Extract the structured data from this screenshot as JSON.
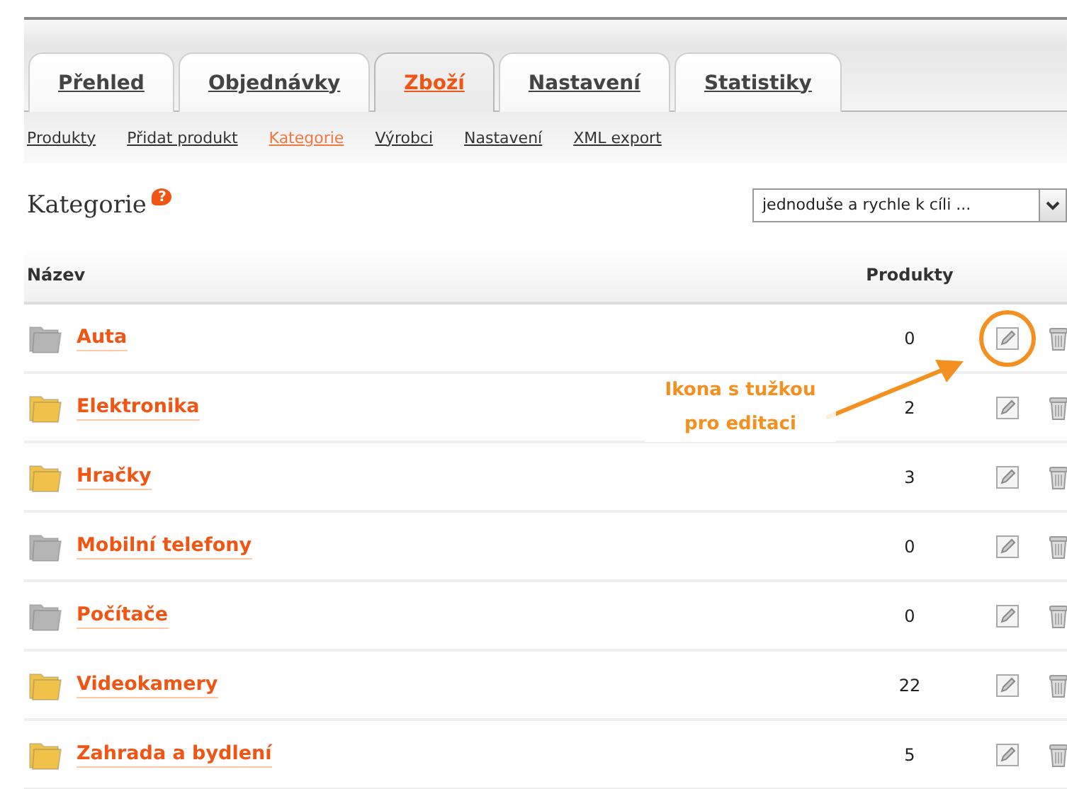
{
  "tabs": [
    {
      "label": "Přehled",
      "selected": false
    },
    {
      "label": "Objednávky",
      "selected": false
    },
    {
      "label": "Zboží",
      "selected": true
    },
    {
      "label": "Nastavení",
      "selected": false
    },
    {
      "label": "Statistiky",
      "selected": false
    }
  ],
  "subnav": [
    {
      "label": "Produkty",
      "selected": false
    },
    {
      "label": "Přidat produkt",
      "selected": false
    },
    {
      "label": "Kategorie",
      "selected": true
    },
    {
      "label": "Výrobci",
      "selected": false
    },
    {
      "label": "Nastavení",
      "selected": false
    },
    {
      "label": "XML export",
      "selected": false
    }
  ],
  "heading": {
    "title": "Kategorie",
    "help": "?"
  },
  "filter": {
    "value": "jednoduše a rychle k cíli ..."
  },
  "table": {
    "columns": [
      "Název",
      "Produkty"
    ],
    "rows": [
      {
        "name": "Auta",
        "products": "0",
        "color": "#b4b4b4",
        "highlighted": true
      },
      {
        "name": "Elektronika",
        "products": "2",
        "color": "#f0c24a",
        "highlighted": false
      },
      {
        "name": "Hračky",
        "products": "3",
        "color": "#f0c24a",
        "highlighted": false
      },
      {
        "name": "Mobilní telefony",
        "products": "0",
        "color": "#b4b4b4",
        "highlighted": false
      },
      {
        "name": "Počítače",
        "products": "0",
        "color": "#b4b4b4",
        "highlighted": false
      },
      {
        "name": "Videokamery",
        "products": "22",
        "color": "#f0c24a",
        "highlighted": false
      },
      {
        "name": "Zahrada a bydlení",
        "products": "5",
        "color": "#f0c24a",
        "highlighted": false
      }
    ]
  },
  "annotation": {
    "lines": [
      "Ikona s tužkou",
      "pro editaci"
    ]
  }
}
